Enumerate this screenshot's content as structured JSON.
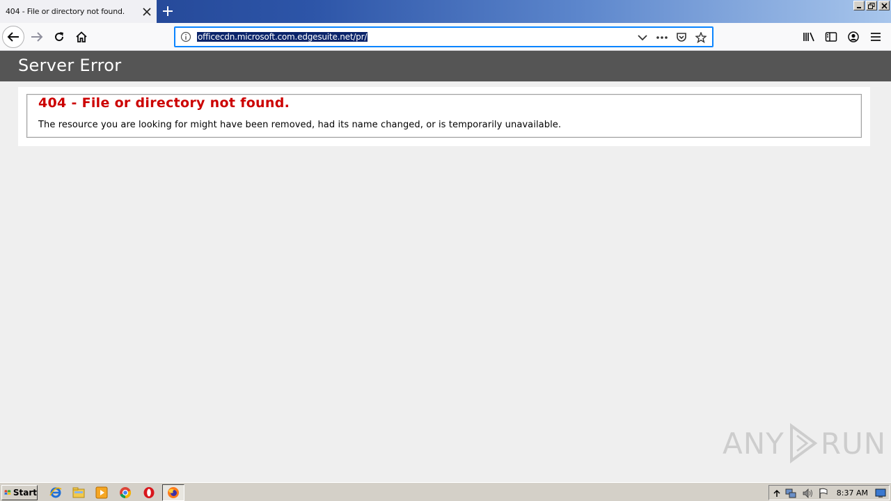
{
  "tab": {
    "title": "404 - File or directory not found."
  },
  "urlbar": {
    "url": "officecdn.microsoft.com.edgesuite.net/pr/"
  },
  "page": {
    "header_title": "Server Error",
    "error_title": "404 - File or directory not found.",
    "error_description": "The resource you are looking for might have been removed, had its name changed, or is temporarily unavailable."
  },
  "taskbar": {
    "start_label": "Start",
    "clock": "8:37 AM"
  },
  "watermark": {
    "text_left": "ANY",
    "text_right": "RUN"
  },
  "colors": {
    "error_red": "#cc0000",
    "header_band": "#555555",
    "selection": "#0a246a"
  }
}
